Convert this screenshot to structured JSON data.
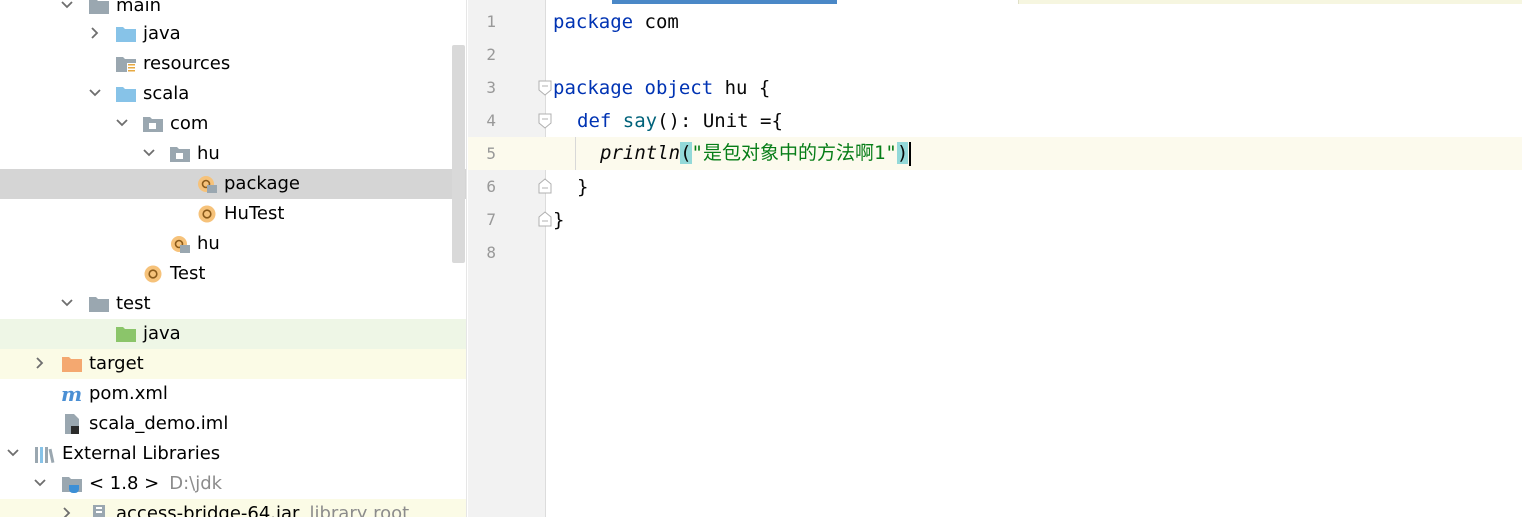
{
  "tree": {
    "items": [
      {
        "label": "main",
        "hint": ""
      },
      {
        "label": "java",
        "hint": ""
      },
      {
        "label": "resources",
        "hint": ""
      },
      {
        "label": "scala",
        "hint": ""
      },
      {
        "label": "com",
        "hint": ""
      },
      {
        "label": "hu",
        "hint": ""
      },
      {
        "label": "package",
        "hint": ""
      },
      {
        "label": "HuTest",
        "hint": ""
      },
      {
        "label": "hu",
        "hint": ""
      },
      {
        "label": "Test",
        "hint": ""
      },
      {
        "label": "test",
        "hint": ""
      },
      {
        "label": "java",
        "hint": ""
      },
      {
        "label": "target",
        "hint": ""
      },
      {
        "label": "pom.xml",
        "hint": ""
      },
      {
        "label": "scala_demo.iml",
        "hint": ""
      },
      {
        "label": "External Libraries",
        "hint": ""
      },
      {
        "label": "< 1.8 >",
        "hint": "D:\\jdk"
      },
      {
        "label": "access-bridge-64.jar",
        "hint": "library root"
      }
    ],
    "selected": "package"
  },
  "editor": {
    "line_numbers": [
      "1",
      "2",
      "3",
      "4",
      "5",
      "6",
      "7",
      "8"
    ],
    "code": {
      "l1_kw": "package",
      "l1_rest": " com",
      "l3_kw1": "package",
      "l3_sp": " ",
      "l3_kw2": "object",
      "l3_rest": " hu {",
      "l4_kw": "def",
      "l4_sp": " ",
      "l4_fn": "say",
      "l4_rest": "(): Unit ={",
      "l5_fn": "println",
      "l5_open": "(",
      "l5_str": "\"是包对象中的方法啊1\"",
      "l5_close": ")",
      "l6": "}",
      "l7": "}"
    },
    "caret_line": "5"
  },
  "colors": {
    "keyword": "#0033b3",
    "string": "#067d17",
    "function": "#00627a",
    "selection": "#d5d5d5",
    "folder_blue": "#87c3e8",
    "folder_gray": "#9aa7b0",
    "folder_green": "#8bc56a",
    "folder_orange": "#f4a870",
    "scala_object": "#f0a732"
  }
}
